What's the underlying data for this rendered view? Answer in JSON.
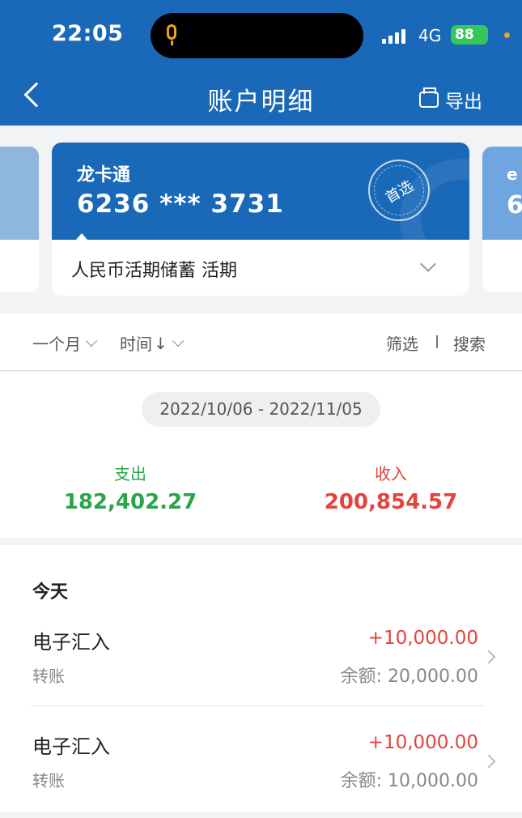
{
  "status_bar": {
    "time": "22:05",
    "network": "4G",
    "battery": "88"
  },
  "header": {
    "title": "账户明细",
    "export_label": "导出"
  },
  "card": {
    "name": "龙卡通",
    "number": "6236 *** 3731",
    "badge": "首选",
    "account_type": "人民币活期储蓄 活期",
    "next_card_name": "e",
    "next_card_number": "6"
  },
  "filters": {
    "period": "一个月",
    "sort": "时间",
    "sort_arrow": "↓",
    "filter": "筛选",
    "search": "搜索"
  },
  "summary": {
    "date_range": "2022/10/06 - 2022/11/05",
    "expense_label": "支出",
    "expense_value": "182,402.27",
    "income_label": "收入",
    "income_value": "200,854.57"
  },
  "transactions": {
    "day": "今天",
    "items": [
      {
        "title": "电子汇入",
        "type": "转账",
        "amount": "+10,000.00",
        "balance": "余额: 20,000.00"
      },
      {
        "title": "电子汇入",
        "type": "转账",
        "amount": "+10,000.00",
        "balance": "余额: 10,000.00"
      }
    ]
  },
  "colors": {
    "brand": "#1a68b8",
    "expense": "#2aa54b",
    "income": "#e2443e"
  }
}
